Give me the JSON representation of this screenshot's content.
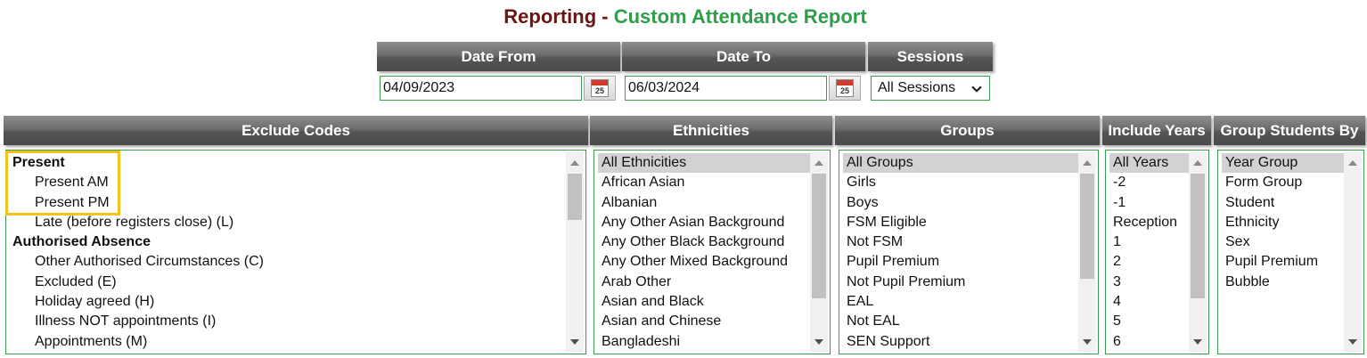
{
  "title": {
    "prefix": "Reporting - ",
    "main": "Custom Attendance Report"
  },
  "filters": {
    "date_from_label": "Date From",
    "date_from_value": "04/09/2023",
    "date_to_label": "Date To",
    "date_to_value": "06/03/2024",
    "calendar_day": "25",
    "sessions_label": "Sessions",
    "sessions_value": "All Sessions"
  },
  "columns": {
    "exclude_codes": {
      "label": "Exclude Codes",
      "items": [
        {
          "text": "Present",
          "kind": "group"
        },
        {
          "text": "Present AM",
          "kind": "sub"
        },
        {
          "text": "Present PM",
          "kind": "sub"
        },
        {
          "text": "Late (before registers close) (L)",
          "kind": "sub"
        },
        {
          "text": "Authorised Absence",
          "kind": "group"
        },
        {
          "text": "Other Authorised Circumstances (C)",
          "kind": "sub"
        },
        {
          "text": "Excluded (E)",
          "kind": "sub"
        },
        {
          "text": "Holiday agreed (H)",
          "kind": "sub"
        },
        {
          "text": "Illness NOT appointments (I)",
          "kind": "sub"
        },
        {
          "text": "Appointments (M)",
          "kind": "sub"
        }
      ]
    },
    "ethnicities": {
      "label": "Ethnicities",
      "items": [
        "All Ethnicities",
        "African Asian",
        "Albanian",
        "Any Other Asian Background",
        "Any Other Black Background",
        "Any Other Mixed Background",
        "Arab Other",
        "Asian and Black",
        "Asian and Chinese",
        "Bangladeshi"
      ],
      "selected": 0
    },
    "groups": {
      "label": "Groups",
      "items": [
        "All Groups",
        "Girls",
        "Boys",
        "FSM Eligible",
        "Not FSM",
        "Pupil Premium",
        "Not Pupil Premium",
        "EAL",
        "Not EAL",
        "SEN Support"
      ],
      "selected": 0
    },
    "include_years": {
      "label": "Include Years",
      "items": [
        "All Years",
        "-2",
        "-1",
        "Reception",
        "1",
        "2",
        "3",
        "4",
        "5",
        "6"
      ],
      "selected": 0
    },
    "group_students_by": {
      "label": "Group Students By",
      "items": [
        "Year Group",
        "Form Group",
        "Student",
        "Ethnicity",
        "Sex",
        "Pupil Premium",
        "Bubble"
      ],
      "selected": 0
    }
  },
  "colors": {
    "header_bg": "#555555",
    "border_green": "#3a9a4e",
    "highlight": "#f6c21b",
    "title_dark": "#6b1414",
    "title_green": "#2e9e4a"
  }
}
